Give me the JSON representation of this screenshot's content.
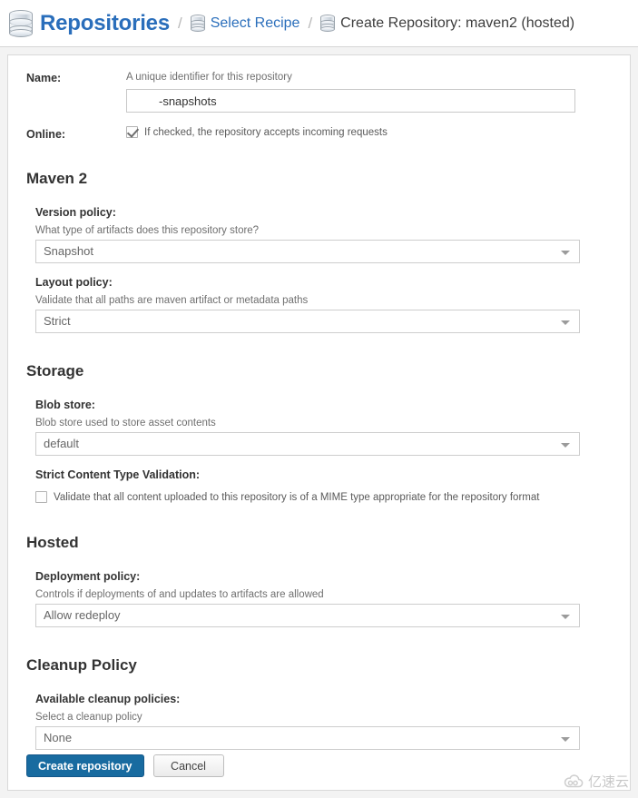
{
  "header": {
    "title": "Repositories",
    "title_icon": "database-icon",
    "separator": "/",
    "breadcrumb": [
      {
        "label": "Select Recipe",
        "icon": "database-icon",
        "type": "link"
      },
      {
        "label": "Create Repository: maven2 (hosted)",
        "icon": "database-icon",
        "type": "current"
      }
    ]
  },
  "form": {
    "name": {
      "label": "Name:",
      "help": "A unique identifier for this repository",
      "value": "-snapshots",
      "placeholder": ""
    },
    "online": {
      "label": "Online:",
      "checkbox_label": "If checked, the repository accepts incoming requests",
      "checked": true
    }
  },
  "sections": [
    {
      "title": "Maven 2",
      "fields": [
        {
          "label": "Version policy:",
          "help": "What type of artifacts does this repository store?",
          "value": "Snapshot",
          "control": "select"
        },
        {
          "label": "Layout policy:",
          "help": "Validate that all paths are maven artifact or metadata paths",
          "value": "Strict",
          "control": "select"
        }
      ]
    },
    {
      "title": "Storage",
      "fields": [
        {
          "label": "Blob store:",
          "help": "Blob store used to store asset contents",
          "value": "default",
          "control": "select"
        },
        {
          "label": "Strict Content Type Validation:",
          "checkbox_label": "Validate that all content uploaded to this repository is of a MIME type appropriate for the repository format",
          "checked": false,
          "control": "checkbox"
        }
      ]
    },
    {
      "title": "Hosted",
      "fields": [
        {
          "label": "Deployment policy:",
          "help": "Controls if deployments of and updates to artifacts are allowed",
          "value": "Allow redeploy",
          "control": "select"
        }
      ]
    },
    {
      "title": "Cleanup Policy",
      "fields": [
        {
          "label": "Available cleanup policies:",
          "help": "Select a cleanup policy",
          "value": "None",
          "control": "select"
        }
      ]
    }
  ],
  "footer": {
    "submit_label": "Create repository",
    "cancel_label": "Cancel"
  },
  "watermark": {
    "text": "亿速云",
    "icon": "cloud-icon"
  },
  "colors": {
    "link": "#2a6ebb",
    "primary_button": "#186ba0",
    "page_background": "#f3f3f3"
  }
}
